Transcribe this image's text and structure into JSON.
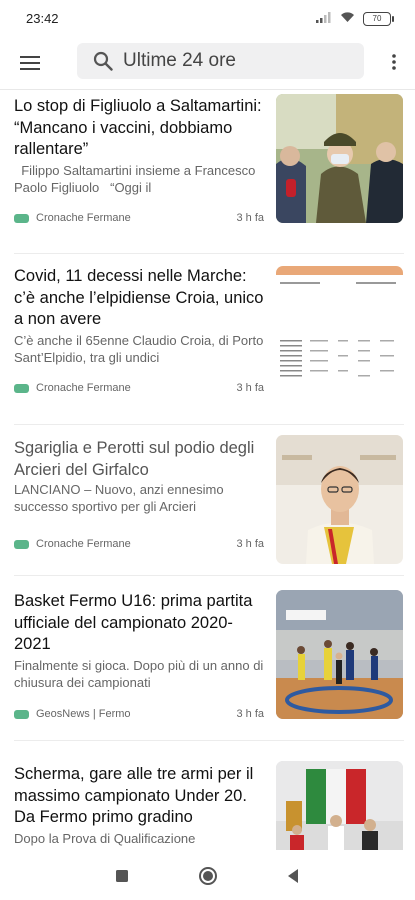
{
  "status": {
    "time": "23:42",
    "battery": "70"
  },
  "app_bar": {
    "search_text": "Ultime 24 ore"
  },
  "colors": {
    "tag": "#5bb58a",
    "search_bg": "#f0f0f1"
  },
  "articles": [
    {
      "title": "Lo stop di Figliuolo a Saltamartini:  “Mancano i vaccini, dobbiamo rallentare”",
      "snippet": "  Filippo Saltamartini insieme a Francesco Paolo Figliuolo   “Oggi il",
      "source": "Cronache Fermane",
      "age": "3 h fa",
      "image": "photo-general-in-uniform"
    },
    {
      "title": "Covid, 11 decessi nelle Marche: c’è anche l’elpidiense Croia, unico a non avere",
      "snippet": "C’è anche il 65enne Claudio Croia, di Porto Sant’Elpidio, tra gli undici",
      "source": "Cronache Fermane",
      "age": "3 h fa",
      "image": "photo-document-table"
    },
    {
      "title": "Sgariglia e Perotti sul podio degli Arcieri del Girfalco",
      "snippet": "LANCIANO – Nuovo, anzi ennesimo successo sportivo per gli Arcieri",
      "source": "Cronache Fermane",
      "age": "3 h fa",
      "image": "photo-man-portrait"
    },
    {
      "title": "Basket Fermo U16: prima partita ufficiale del campionato 2020-2021",
      "snippet": "Finalmente si gioca. Dopo più di un anno di chiusura dei campionati",
      "source": "GeosNews | Fermo",
      "age": "3 h fa",
      "image": "photo-basketball-game"
    },
    {
      "title": "Scherma, gare alle tre armi per il massimo campionato Under 20. Da Fermo primo gradino",
      "snippet": "Dopo la Prova di Qualificazione",
      "source": "",
      "age": "",
      "image": "photo-fencing-podium"
    }
  ]
}
